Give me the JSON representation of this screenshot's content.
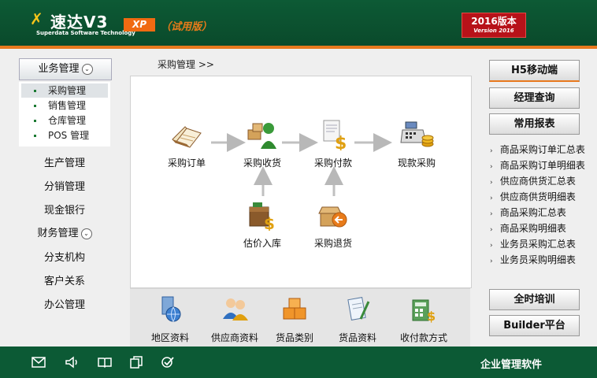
{
  "header": {
    "logo_text": "速达V3",
    "logo_subtitle": "Superdata Software Technology",
    "edition_badge": "XP",
    "trial_label": "（试用版）",
    "version_line1": "2016版本",
    "version_line2": "Version 2016"
  },
  "left_nav": {
    "business_header": "业务管理",
    "sub_items": [
      "采购管理",
      "销售管理",
      "仓库管理",
      "POS 管理"
    ],
    "items": [
      "生产管理",
      "分销管理",
      "现金银行"
    ],
    "finance_header": "财务管理",
    "items_after": [
      "分支机构",
      "客户关系",
      "办公管理"
    ]
  },
  "breadcrumb": "采购管理 >>",
  "flow": {
    "order": "采购订单",
    "receive": "采购收货",
    "payment": "采购付款",
    "cash_purchase": "现款采购",
    "estimate": "估价入库",
    "return": "采购退货"
  },
  "resources": [
    "地区资料",
    "供应商资料",
    "货品类别",
    "货品资料",
    "收付款方式"
  ],
  "right_panel": {
    "h5_button": "H5移动端",
    "manager_button": "经理查询",
    "reports_button": "常用报表",
    "reports": [
      "商品采购订单汇总表",
      "商品采购订单明细表",
      "供应商供货汇总表",
      "供应商供货明细表",
      "商品采购汇总表",
      "商品采购明细表",
      "业务员采购汇总表",
      "业务员采购明细表"
    ],
    "training_button": "全时培训",
    "builder_button": "Builder平台"
  },
  "footer": {
    "icons": [
      "mail-icon",
      "speaker-icon",
      "book-icon",
      "copy-icon",
      "check-circle-icon"
    ],
    "label": "企业管理软件"
  },
  "colors": {
    "header_green": "#0d5a35",
    "accent_orange": "#e8791e",
    "version_red": "#b71219"
  }
}
